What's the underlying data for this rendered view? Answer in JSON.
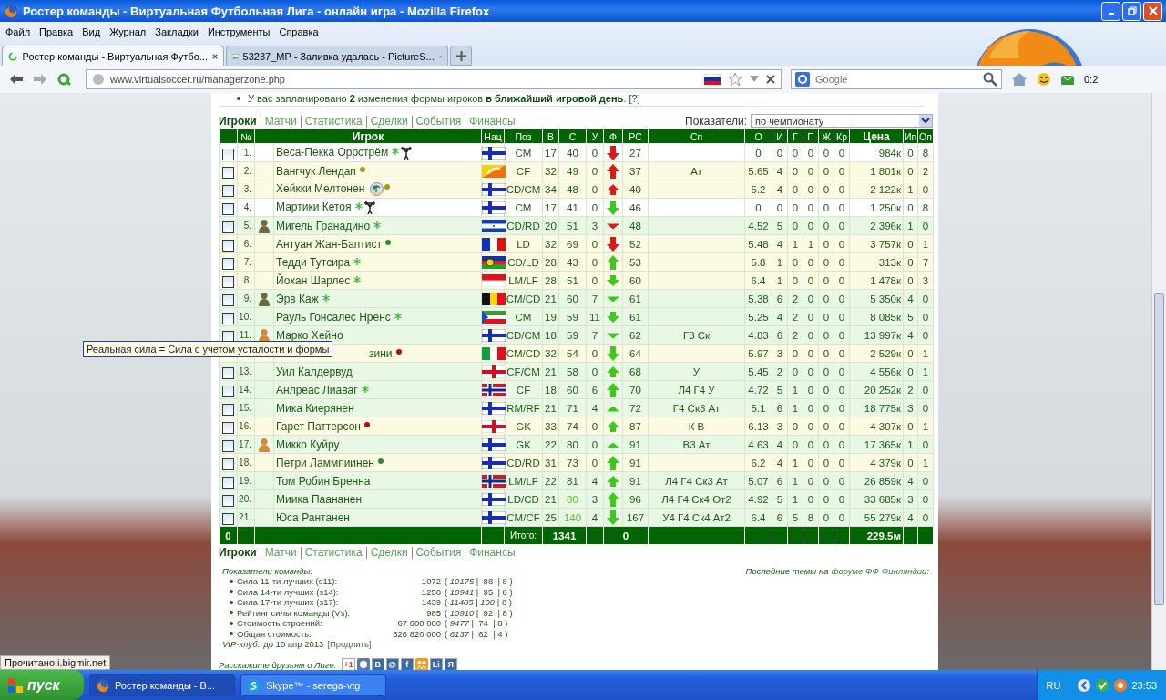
{
  "window": {
    "title": "Ростер команды - Виртуальная Футбольная Лига - онлайн игра - Mozilla Firefox"
  },
  "menu": [
    "Файл",
    "Правка",
    "Вид",
    "Журнал",
    "Закладки",
    "Инструменты",
    "Справка"
  ],
  "tabs": [
    {
      "label": "Ростер команды - Виртуальная Футбо...",
      "selected": true
    },
    {
      "label": "53237_MP - Заливка удалась - PictureS...",
      "selected": false
    }
  ],
  "address": {
    "url": "www.virtualsoccer.ru/managerzone.php"
  },
  "search": {
    "placeholder": "Google"
  },
  "addon_counter": "0:2",
  "page": {
    "notice": "У вас запланировано **2** изменения формы игроков **в ближайший игровой день**. [?]",
    "nav": [
      {
        "label": "Игроки",
        "selected": true
      },
      {
        "label": "Матчи",
        "selected": false
      },
      {
        "label": "Статистика",
        "selected": false
      },
      {
        "label": "Сделки",
        "selected": false
      },
      {
        "label": "События",
        "selected": false
      },
      {
        "label": "Финансы",
        "selected": false
      }
    ],
    "indicator": {
      "label": "Показатели:",
      "value": "по чемпионату"
    },
    "table": {
      "columns": [
        {
          "label": "№",
          "bold": false
        },
        {
          "label": "Игрок",
          "bold": true
        },
        {
          "label": "Нац",
          "bold": false
        },
        {
          "label": "Поз",
          "bold": false
        },
        {
          "label": "В",
          "bold": false
        },
        {
          "label": "С",
          "bold": false
        },
        {
          "label": "У",
          "bold": false
        },
        {
          "label": "Ф",
          "bold": false
        },
        {
          "label": "РС",
          "bold": false
        },
        {
          "label": "Сп",
          "bold": false
        },
        {
          "label": "О",
          "bold": false
        },
        {
          "label": "И",
          "bold": false
        },
        {
          "label": "Г",
          "bold": false
        },
        {
          "label": "П",
          "bold": false
        },
        {
          "label": "Ж",
          "bold": false
        },
        {
          "label": "Кр",
          "bold": false
        },
        {
          "label": "Цена",
          "bold": true
        },
        {
          "label": "Ип",
          "bold": false
        },
        {
          "label": "Оп",
          "bold": false
        }
      ],
      "rows": [
        {
          "checked": false,
          "num": "1.",
          "name": "Веса-Пекка Оррстрём",
          "icons": [
            {
              "kind": "star"
            },
            {
              "kind": "lifter"
            }
          ],
          "flag": {
            "kind": "finland"
          },
          "stats": [
            "CM",
            "17",
            "40",
            "0"
          ],
          "skill_up": false,
          "form": {
            "kind": "down",
            "color": "#d81c1c"
          },
          "rs": "27",
          "values": [
            "0",
            "0",
            "0",
            "0",
            "0",
            "0",
            "984к",
            "0",
            "8"
          ],
          "color": "#ffffff"
        },
        {
          "checked": false,
          "num": "2.",
          "name": "Вангчук Лендап",
          "icons": [
            {
              "kind": "dot",
              "color": "#a89a10"
            }
          ],
          "flag": {
            "kind": "bhutan"
          },
          "stats": [
            "CF",
            "32",
            "49",
            "0"
          ],
          "skill_up": false,
          "form": {
            "kind": "up",
            "color": "#d81c1c"
          },
          "rs": "37",
          "specials": "Ат",
          "values": [
            "5.65",
            "4",
            "0",
            "0",
            "0",
            "0",
            "1 801к",
            "0",
            "2"
          ],
          "color": "#fdfae3"
        },
        {
          "checked": false,
          "num": "3.",
          "name": "Хейкки Мелтонен",
          "icons": [
            {
              "kind": "palm"
            },
            {
              "kind": "dot",
              "color": "#a89a10"
            }
          ],
          "flag": {
            "kind": "finland"
          },
          "stats": [
            "CD/CM",
            "34",
            "48",
            "0"
          ],
          "skill_up": false,
          "form": {
            "kind": "upsmall",
            "color": "#d81c1c"
          },
          "rs": "40",
          "values": [
            "5.2",
            "4",
            "0",
            "0",
            "0",
            "0",
            "2 122к",
            "1",
            "0"
          ],
          "color": "#fdfae3"
        },
        {
          "checked": false,
          "num": "4.",
          "name": "Мартики Кетоя",
          "icons": [
            {
              "kind": "star"
            },
            {
              "kind": "lifter"
            }
          ],
          "flag": {
            "kind": "finland"
          },
          "stats": [
            "CM",
            "17",
            "41",
            "0"
          ],
          "skill_up": false,
          "form": {
            "kind": "down",
            "color": "#3cc81e"
          },
          "rs": "46",
          "values": [
            "0",
            "0",
            "0",
            "0",
            "0",
            "0",
            "1 250к",
            "0",
            "8"
          ],
          "color": "#ffffff"
        },
        {
          "checked": false,
          "num": "5.",
          "photo": {
            "kind": "soldier"
          },
          "name": "Мигель Гранадино",
          "icons": [
            {
              "kind": "star"
            }
          ],
          "flag": {
            "kind": "honduras"
          },
          "stats": [
            "CD/RD",
            "20",
            "51",
            "3"
          ],
          "skill_up": false,
          "form": {
            "kind": "tridown",
            "color": "#d81c1c"
          },
          "rs": "48",
          "values": [
            "4.52",
            "5",
            "0",
            "0",
            "0",
            "0",
            "2 396к",
            "1",
            "0"
          ],
          "color": "#e9f8e5"
        },
        {
          "checked": false,
          "num": "6.",
          "name": "Антуан Жан-Баптист",
          "icons": [
            {
              "kind": "dot",
              "color": "#2e8b2e"
            }
          ],
          "flag": {
            "kind": "france"
          },
          "stats": [
            "LD",
            "32",
            "69",
            "0"
          ],
          "skill_up": false,
          "form": {
            "kind": "down",
            "color": "#d81c1c"
          },
          "rs": "52",
          "values": [
            "5.48",
            "4",
            "1",
            "1",
            "0",
            "0",
            "3 757к",
            "0",
            "1"
          ],
          "color": "#fdfae3"
        },
        {
          "checked": false,
          "num": "7.",
          "name": "Тедди Тутсира",
          "icons": [
            {
              "kind": "star"
            }
          ],
          "flag": {
            "kind": "newcaledonia"
          },
          "stats": [
            "CD/LD",
            "28",
            "43",
            "0"
          ],
          "skill_up": false,
          "form": {
            "kind": "up",
            "color": "#3cc81e"
          },
          "rs": "53",
          "values": [
            "5.8",
            "1",
            "0",
            "0",
            "0",
            "0",
            "313к",
            "0",
            "7"
          ],
          "color": "#fdfae3"
        },
        {
          "checked": false,
          "num": "8.",
          "name": "Йохан Шарлес",
          "icons": [
            {
              "kind": "star"
            }
          ],
          "flag": {
            "kind": "monaco"
          },
          "stats": [
            "LM/LF",
            "28",
            "51",
            "0"
          ],
          "skill_up": false,
          "form": {
            "kind": "downsmall",
            "color": "#3cc81e"
          },
          "rs": "60",
          "values": [
            "6.4",
            "1",
            "0",
            "0",
            "0",
            "0",
            "1 478к",
            "0",
            "3"
          ],
          "color": "#fdfae3"
        },
        {
          "checked": false,
          "num": "9.",
          "photo": {
            "kind": "soldier"
          },
          "name": "Эрв Каж",
          "icons": [
            {
              "kind": "star"
            }
          ],
          "flag": {
            "kind": "belgium"
          },
          "stats": [
            "CM/CD",
            "21",
            "60",
            "7"
          ],
          "skill_up": false,
          "form": {
            "kind": "tridown",
            "color": "#3cc81e"
          },
          "rs": "61",
          "values": [
            "5.38",
            "6",
            "2",
            "0",
            "0",
            "0",
            "5 350к",
            "4",
            "0"
          ],
          "color": "#e9f8e5"
        },
        {
          "checked": false,
          "num": "10.",
          "name": "Рауль Гонсалес Нренс",
          "icons": [
            {
              "kind": "star"
            }
          ],
          "flag": {
            "kind": "eqguinea"
          },
          "stats": [
            "CM",
            "19",
            "59",
            "11"
          ],
          "skill_up": false,
          "form": {
            "kind": "downsmall",
            "color": "#3cc81e"
          },
          "rs": "61",
          "values": [
            "5.25",
            "4",
            "2",
            "0",
            "0",
            "0",
            "8 085к",
            "5",
            "0"
          ],
          "color": "#e9f8e5"
        },
        {
          "checked": false,
          "num": "11.",
          "photo": {
            "kind": "orange"
          },
          "name": "Марко Хейно",
          "icons": [],
          "flag": {
            "kind": "finland"
          },
          "stats": [
            "CD/CM",
            "18",
            "59",
            "7"
          ],
          "skill_up": false,
          "form": {
            "kind": "tridown",
            "color": "#3cc81e"
          },
          "rs": "62",
          "specials": "Г3 Ск",
          "values": [
            "4.83",
            "6",
            "2",
            "0",
            "0",
            "0",
            "13 997к",
            "4",
            "0"
          ],
          "color": "#e9f8e5"
        },
        {
          "tooltip": "Реальная сила = Сила с учетом усталости и формы",
          "name": "зини",
          "icons": [
            {
              "kind": "dot",
              "color": "#b01010"
            }
          ],
          "flag": {
            "kind": "italy"
          },
          "stats": [
            "CM/CD",
            "32",
            "54",
            "0"
          ],
          "skill_up": false,
          "form": {
            "kind": "down",
            "color": "#3cc81e"
          },
          "rs": "64",
          "values": [
            "5.97",
            "3",
            "0",
            "0",
            "0",
            "0",
            "2 529к",
            "0",
            "1"
          ],
          "color": "#fdfae3"
        },
        {
          "checked": false,
          "num": "13.",
          "name": "Уил Калдервуд",
          "icons": [],
          "flag": {
            "kind": "nireland"
          },
          "stats": [
            "CF/CM",
            "21",
            "58",
            "0"
          ],
          "skill_up": false,
          "form": {
            "kind": "upsmall",
            "color": "#3cc81e"
          },
          "rs": "68",
          "specials": "У",
          "values": [
            "5.45",
            "2",
            "0",
            "0",
            "0",
            "0",
            "4 556к",
            "0",
            "1"
          ],
          "color": "#e9f8e5"
        },
        {
          "checked": false,
          "num": "14.",
          "name": "Анлреас Лиаваг",
          "icons": [
            {
              "kind": "star"
            }
          ],
          "flag": {
            "kind": "norway"
          },
          "stats": [
            "CF",
            "18",
            "60",
            "6"
          ],
          "skill_up": false,
          "form": {
            "kind": "up",
            "color": "#3cc81e"
          },
          "rs": "70",
          "specials": "Л4 Г4 У",
          "values": [
            "4.72",
            "5",
            "1",
            "0",
            "0",
            "0",
            "20 252к",
            "2",
            "0"
          ],
          "color": "#e9f8e5"
        },
        {
          "checked": false,
          "num": "15.",
          "name": "Мика Киерянен",
          "icons": [],
          "flag": {
            "kind": "finland"
          },
          "stats": [
            "RM/RF",
            "21",
            "71",
            "4"
          ],
          "skill_up": false,
          "form": {
            "kind": "triup",
            "color": "#3cc81e"
          },
          "rs": "72",
          "specials": "Г4 Ск3 Ат",
          "values": [
            "5.1",
            "6",
            "1",
            "0",
            "0",
            "0",
            "18 775к",
            "3",
            "0"
          ],
          "color": "#e9f8e5"
        },
        {
          "checked": false,
          "num": "16.",
          "name": "Гарет Паттерсон",
          "icons": [
            {
              "kind": "dot",
              "color": "#b01010"
            }
          ],
          "flag": {
            "kind": "nireland"
          },
          "stats": [
            "GK",
            "33",
            "74",
            "0"
          ],
          "skill_up": false,
          "form": {
            "kind": "upsmall",
            "color": "#3cc81e"
          },
          "rs": "87",
          "specials": "К В",
          "values": [
            "6.13",
            "3",
            "0",
            "0",
            "0",
            "0",
            "4 307к",
            "0",
            "1"
          ],
          "color": "#fdfae3"
        },
        {
          "checked": false,
          "num": "17.",
          "photo": {
            "kind": "orange"
          },
          "name": "Микко Куйру",
          "icons": [],
          "flag": {
            "kind": "finland"
          },
          "stats": [
            "GK",
            "22",
            "80",
            "0"
          ],
          "skill_up": false,
          "form": {
            "kind": "triup",
            "color": "#3cc81e"
          },
          "rs": "91",
          "specials": "В3 Ат",
          "values": [
            "4.63",
            "4",
            "0",
            "0",
            "0",
            "0",
            "17 365к",
            "1",
            "0"
          ],
          "color": "#e9f8e5"
        },
        {
          "checked": false,
          "num": "18.",
          "name": "Петри Ламмпиинен",
          "icons": [
            {
              "kind": "dot",
              "color": "#2e8b2e"
            }
          ],
          "flag": {
            "kind": "finland"
          },
          "stats": [
            "CD/RD",
            "31",
            "73",
            "0"
          ],
          "skill_up": false,
          "form": {
            "kind": "up",
            "color": "#3cc81e"
          },
          "rs": "91",
          "values": [
            "6.2",
            "4",
            "1",
            "0",
            "0",
            "0",
            "4 379к",
            "0",
            "1"
          ],
          "color": "#fdfae3"
        },
        {
          "checked": false,
          "num": "19.",
          "name": "Том Робин Бренна",
          "icons": [],
          "flag": {
            "kind": "norway"
          },
          "stats": [
            "LM/LF",
            "22",
            "81",
            "4"
          ],
          "skill_up": false,
          "form": {
            "kind": "upsmall",
            "color": "#3cc81e"
          },
          "rs": "91",
          "specials": "Л4 Г4 Ск3 Ат",
          "values": [
            "5.07",
            "6",
            "1",
            "0",
            "0",
            "0",
            "26 859к",
            "4",
            "0"
          ],
          "color": "#e9f8e5"
        },
        {
          "checked": false,
          "num": "20.",
          "name": "Миика Паананен",
          "icons": [],
          "flag": {
            "kind": "finland"
          },
          "stats": [
            "LD/CD",
            "21",
            "80",
            "3"
          ],
          "skill_up": true,
          "form": {
            "kind": "up",
            "color": "#3cc81e"
          },
          "rs": "96",
          "specials": "Л4 Г4 Ск4 От2",
          "values": [
            "4.92",
            "5",
            "1",
            "0",
            "0",
            "0",
            "33 685к",
            "3",
            "0"
          ],
          "color": "#e9f8e5"
        },
        {
          "checked": false,
          "num": "21.",
          "name": "Юса Рантанен",
          "icons": [],
          "flag": {
            "kind": "finland"
          },
          "stats": [
            "CM/CF",
            "25",
            "140",
            "4"
          ],
          "skill_up": true,
          "form": {
            "kind": "down",
            "color": "#3cc81e"
          },
          "rs": "167",
          "specials": "У4 Г4 Ск4 Ат2",
          "values": [
            "6.4",
            "6",
            "5",
            "8",
            "0",
            "0",
            "55 279к",
            "4",
            "0"
          ],
          "color": "#e9f8e5"
        }
      ],
      "total": {
        "count": "0",
        "label": "Итого:",
        "skill_sum": "1341",
        "form_sum": "0",
        "price_sum": "229.5м"
      }
    },
    "nav_bottom": [
      {
        "label": "Игроки",
        "selected": true
      },
      {
        "label": "Матчи",
        "selected": false
      },
      {
        "label": "Статистика",
        "selected": false
      },
      {
        "label": "Сделки",
        "selected": false
      },
      {
        "label": "События",
        "selected": false
      },
      {
        "label": "Финансы",
        "selected": false
      }
    ],
    "team_stats": {
      "title": "Показатели команды:",
      "items": [
        {
          "label": "Сила 11-ти лучших (s11):",
          "value": "1072",
          "detail": "( *10175* |  88  | 8 )"
        },
        {
          "label": "Сила 14-ти лучших (s14):",
          "value": "1250",
          "detail": "( *10941* |  95  | 8 )"
        },
        {
          "label": "Сила 17-ти лучших (s17):",
          "value": "1439",
          "detail": "( *11485* | *100* | 8 )"
        },
        {
          "label": "Рейтинг силы команды (Vs):",
          "value": "985",
          "detail": "( *10910* |  92  | 8 )"
        },
        {
          "label": "Стоимость строений:",
          "value": "67 600 000",
          "detail": "( *9477* |  74  | 8 )"
        },
        {
          "label": "Общая стоимость:",
          "value": "326 820 000",
          "detail": "( *6137* |  62  | 4 )"
        }
      ]
    },
    "vip": {
      "label": "VIP-клуб:",
      "text": "до 10 апр 2013",
      "link": "[Продлить]"
    },
    "forum": {
      "text": "Последние темы на",
      "link": "форуме ФФ Финляндии:"
    },
    "share": {
      "label": "Расскажите друзьям о Лиге:",
      "items": [
        {
          "kind": "gplus",
          "label": "+1"
        },
        {
          "kind": "icon"
        },
        {
          "kind": "letter",
          "label": "В"
        },
        {
          "kind": "letter",
          "label": "@"
        },
        {
          "kind": "letter",
          "label": "f"
        },
        {
          "kind": "people"
        },
        {
          "kind": "letter",
          "label": "Li"
        },
        {
          "kind": "letter",
          "label": "Я"
        }
      ]
    }
  },
  "status_bar": "Прочитано i.bigmir.net",
  "taskbar": {
    "start": "пуск",
    "tasks": [
      {
        "label": "Ростер команды - В...",
        "selected": true,
        "kind": "firefox"
      },
      {
        "label": "Skype™ - serega-vtg",
        "selected": false,
        "kind": "skype"
      }
    ],
    "language": "RU",
    "time": "23:53"
  }
}
